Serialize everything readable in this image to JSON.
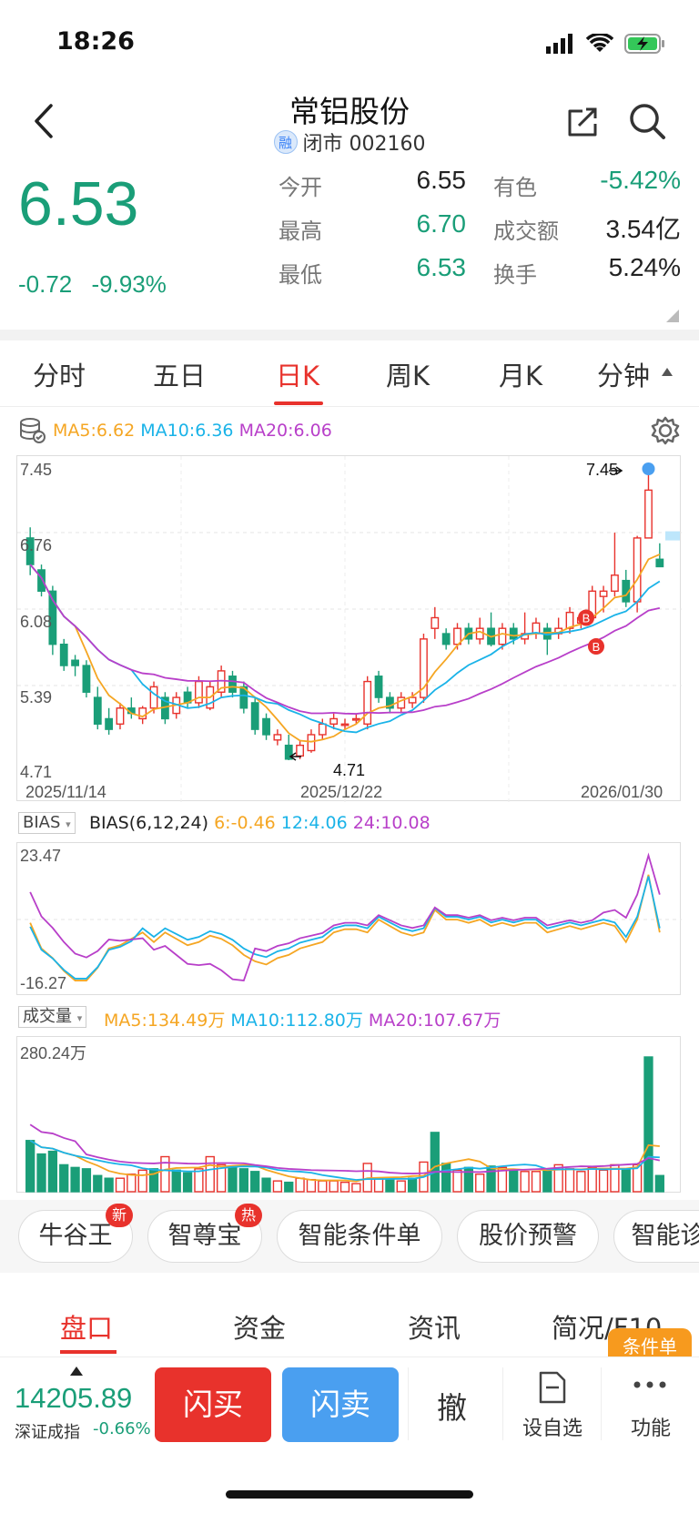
{
  "status": {
    "time": "18:26"
  },
  "header": {
    "title": "常铝股份",
    "rong": "融",
    "subtitle": "闭市 002160"
  },
  "quote": {
    "price": "6.53",
    "change": "-0.72",
    "change_pct": "-9.93%",
    "rows": [
      {
        "l1": "今开",
        "v1": "6.55",
        "l2": "有色",
        "v2": "-5.42%"
      },
      {
        "l1": "最高",
        "v1": "6.70",
        "l2": "成交额",
        "v2": "3.54亿"
      },
      {
        "l1": "最低",
        "v1": "6.53",
        "l2": "换手",
        "v2": "5.24%"
      }
    ]
  },
  "tabs": [
    "分时",
    "五日",
    "日K",
    "周K",
    "月K",
    "分钟"
  ],
  "active_tab": "日K",
  "kline": {
    "ma5": "MA5:6.62",
    "ma10": "MA10:6.36",
    "ma20": "MA20:6.06",
    "y_labels": [
      "7.45",
      "6.76",
      "6.08",
      "5.39",
      "4.71"
    ],
    "x_labels": [
      "2025/11/14",
      "2025/12/22",
      "2026/01/30"
    ],
    "high_annot": "7.45",
    "low_annot": "4.71",
    "marker": "B"
  },
  "bias": {
    "selector": "BIAS",
    "label": "BIAS(6,12,24)",
    "v6": "6:-0.46",
    "v12": "12:4.06",
    "v24": "24:10.08",
    "y_top": "23.47",
    "y_bottom": "-16.27"
  },
  "volume": {
    "selector": "成交量",
    "ma5": "MA5:134.49万",
    "ma10": "MA10:112.80万",
    "ma20": "MA20:107.67万",
    "y_top": "280.24万"
  },
  "tools": [
    {
      "label": "牛谷王",
      "badge": "新"
    },
    {
      "label": "智尊宝",
      "badge": "热"
    },
    {
      "label": "智能条件单",
      "badge": ""
    },
    {
      "label": "股价预警",
      "badge": ""
    },
    {
      "label": "智能诊",
      "badge": ""
    }
  ],
  "bottom_tabs": [
    "盘口",
    "资金",
    "资讯",
    "简况/F10"
  ],
  "condition_badge": "条件单",
  "trade": {
    "index_value": "14205.89",
    "index_name": "深证成指",
    "index_change": "-0.66%",
    "buy": "闪买",
    "sell": "闪卖",
    "cancel": "撤",
    "watch": "设自选",
    "more": "功能"
  },
  "colors": {
    "up": "#e8322c",
    "down": "#1a9e78",
    "ma5": "#f5a623",
    "ma10": "#1ab3e8",
    "ma20": "#b83fc9"
  }
}
